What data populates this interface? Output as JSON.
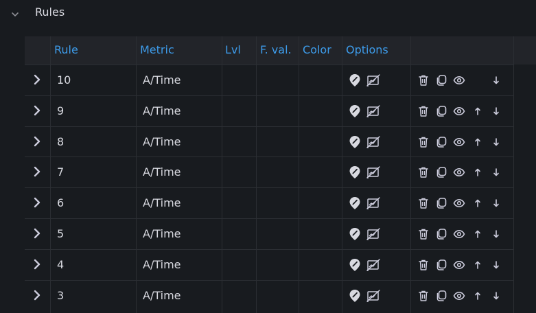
{
  "section": {
    "title": "Rules",
    "collapse_icon": "chevron-down-icon"
  },
  "table": {
    "columns": [
      "Rule",
      "Metric",
      "Lvl",
      "F. val.",
      "Color",
      "Options"
    ],
    "rows": [
      {
        "rule": "10",
        "metric": "A/Time",
        "lvl": "",
        "fval": "",
        "color": "",
        "has_up": false,
        "has_down": true
      },
      {
        "rule": "9",
        "metric": "A/Time",
        "lvl": "",
        "fval": "",
        "color": "",
        "has_up": true,
        "has_down": true
      },
      {
        "rule": "8",
        "metric": "A/Time",
        "lvl": "",
        "fval": "",
        "color": "",
        "has_up": true,
        "has_down": true
      },
      {
        "rule": "7",
        "metric": "A/Time",
        "lvl": "",
        "fval": "",
        "color": "",
        "has_up": true,
        "has_down": true
      },
      {
        "rule": "6",
        "metric": "A/Time",
        "lvl": "",
        "fval": "",
        "color": "",
        "has_up": true,
        "has_down": true
      },
      {
        "rule": "5",
        "metric": "A/Time",
        "lvl": "",
        "fval": "",
        "color": "",
        "has_up": true,
        "has_down": true
      },
      {
        "rule": "4",
        "metric": "A/Time",
        "lvl": "",
        "fval": "",
        "color": "",
        "has_up": true,
        "has_down": true
      },
      {
        "rule": "3",
        "metric": "A/Time",
        "lvl": "",
        "fval": "",
        "color": "",
        "has_up": true,
        "has_down": true
      }
    ],
    "row_icons": {
      "expander": "chevron-right-icon",
      "option_1": "map-pin-icon",
      "option_2": "chart-disabled-icon",
      "delete": "trash-icon",
      "duplicate": "copy-icon",
      "visibility": "eye-icon",
      "move_up": "arrow-up-icon",
      "move_down": "arrow-down-icon"
    }
  },
  "colors": {
    "background": "#181b1f",
    "header_background": "#222429",
    "header_text": "#3d9be9",
    "text": "#d8d9e0",
    "icon": "#ccccdc",
    "grid": "#2b2e33"
  }
}
